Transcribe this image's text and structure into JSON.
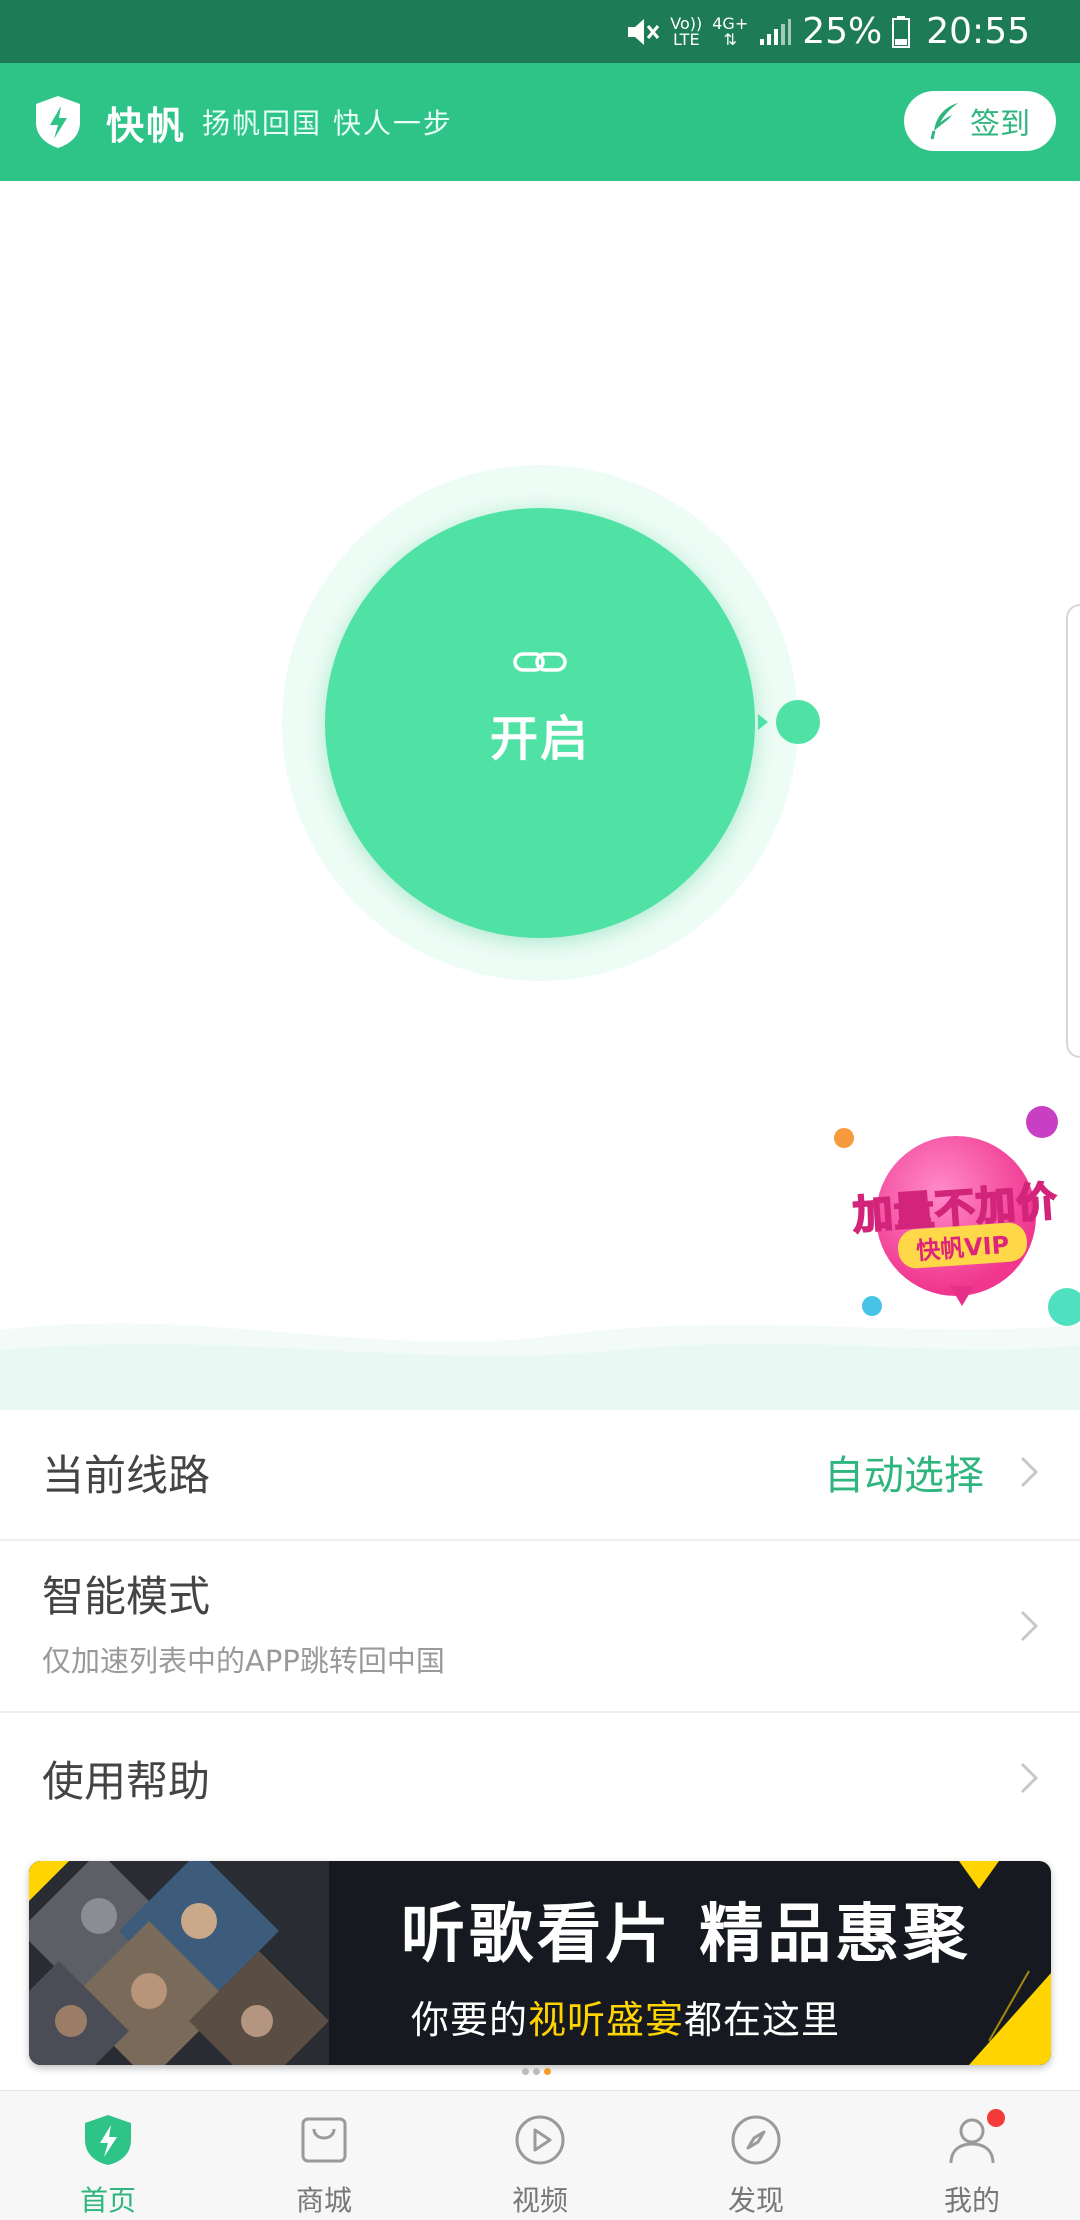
{
  "status_bar": {
    "volte_top": "Vo))",
    "volte_bottom": "LTE",
    "network": "4G+",
    "battery": "25%",
    "time": "20:55"
  },
  "header": {
    "brand": "快帆",
    "slogan": "扬帆回国 快人一步",
    "signin_label": "签到",
    "logo_icon": "lightning-shield-icon"
  },
  "connect": {
    "label": "开启",
    "icon": "link-icon"
  },
  "promo": {
    "headline": "加量不加价",
    "tag": "快帆VIP"
  },
  "settings": {
    "route": {
      "title": "当前线路",
      "value": "自动选择"
    },
    "smart": {
      "title": "智能模式",
      "subtitle": "仅加速列表中的APP跳转回中国"
    },
    "help": {
      "title": "使用帮助"
    }
  },
  "banner": {
    "title": "听歌看片 精品惠聚",
    "subtitle_before": "你要的",
    "subtitle_highlight": "视听盛宴",
    "subtitle_after": "都在这里"
  },
  "bottom_nav": {
    "items": [
      {
        "label": "首页",
        "icon": "home-shield-icon"
      },
      {
        "label": "商城",
        "icon": "shopping-bag-icon"
      },
      {
        "label": "视频",
        "icon": "play-icon"
      },
      {
        "label": "发现",
        "icon": "compass-icon"
      },
      {
        "label": "我的",
        "icon": "user-icon"
      }
    ]
  },
  "colors": {
    "primary": "#2fc487",
    "status_bar": "#1d7c56",
    "connect_circle": "#4fe2a4",
    "accent_text": "#2fb57e",
    "badge": "#f53a3a",
    "highlight": "#ffd400"
  }
}
